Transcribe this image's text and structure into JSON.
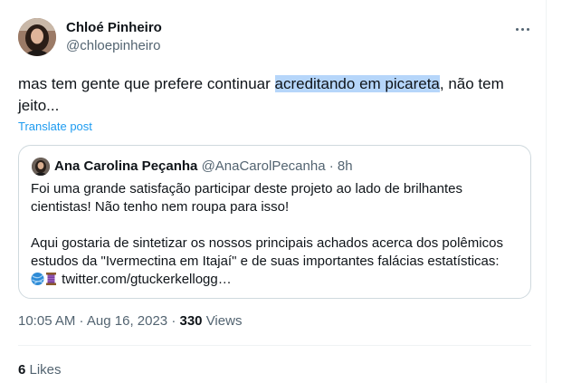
{
  "author": {
    "name": "Chloé Pinheiro",
    "handle": "@chloepinheiro"
  },
  "post": {
    "text_before": "mas tem gente que prefere continuar ",
    "text_highlight": "acreditando em picareta",
    "text_after": ", não tem jeito...",
    "translate_label": "Translate post"
  },
  "quoted": {
    "name": "Ana Carolina Peçanha",
    "handle": "@AnaCarolPecanha",
    "separator": "·",
    "time": "8h",
    "line1": "Foi uma grande satisfação participar deste projeto ao lado de brilhantes cientistas! Não tenho nem roupa para isso!",
    "line2": "Aqui gostaria de sintetizar os nossos principais achados acerca dos polêmicos estudos da \"Ivermectina em Itajaí\" e de suas importantes falácias estatísticas:",
    "link": "twitter.com/gtuckerkellogg…",
    "emoji_icons": [
      "yarn-ball-icon",
      "thread-spool-icon"
    ]
  },
  "meta": {
    "time": "10:05 AM",
    "separator1": " · ",
    "date": "Aug 16, 2023",
    "separator2": " · ",
    "views_count": "330",
    "views_label": " Views"
  },
  "stats": {
    "likes_count": "6",
    "likes_label": " Likes"
  },
  "colors": {
    "link": "#1d9bf0",
    "secondary_text": "#536471",
    "highlight": "#b6d6fa",
    "border": "#cfd9de"
  }
}
